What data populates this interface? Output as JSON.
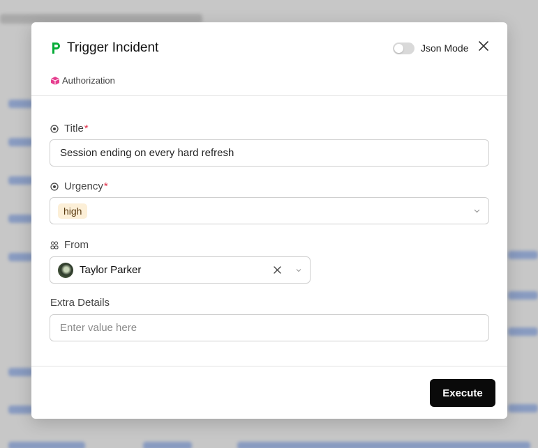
{
  "modal": {
    "title": "Trigger Incident",
    "json_mode_label": "Json Mode",
    "json_mode_on": false,
    "auth_label": "Authorization"
  },
  "fields": {
    "title": {
      "label": "Title",
      "required_mark": "*",
      "value": "Session ending on every hard refresh"
    },
    "urgency": {
      "label": "Urgency",
      "required_mark": "*",
      "value": "high"
    },
    "from": {
      "label": "From",
      "value": "Taylor Parker"
    },
    "extra": {
      "label": "Extra Details",
      "placeholder": "Enter value here"
    }
  },
  "footer": {
    "execute_label": "Execute"
  },
  "colors": {
    "brand_green": "#06ac38",
    "required_red": "#e0334d",
    "auth_pink": "#e63e8f",
    "badge_bg": "#fcefd7"
  },
  "icons": [
    "pagerduty-logo-icon",
    "close-icon",
    "cube-icon",
    "target-icon",
    "users-icon",
    "chevron-down-icon",
    "clear-icon"
  ]
}
